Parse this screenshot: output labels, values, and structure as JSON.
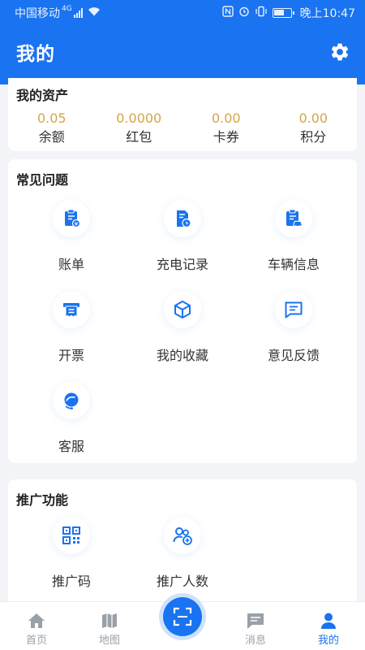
{
  "status_bar": {
    "carrier": "中国移动",
    "network": "4G",
    "time": "晚上10:47"
  },
  "header": {
    "title": "我的"
  },
  "assets": {
    "title": "我的资产",
    "items": [
      {
        "value": "0.05",
        "label": "余额"
      },
      {
        "value": "0.0000",
        "label": "红包"
      },
      {
        "value": "0.00",
        "label": "卡券"
      },
      {
        "value": "0.00",
        "label": "积分"
      }
    ]
  },
  "faq": {
    "title": "常见问题",
    "items": [
      {
        "label": "账单",
        "icon": "bill-icon"
      },
      {
        "label": "充电记录",
        "icon": "charging-record-icon"
      },
      {
        "label": "车辆信息",
        "icon": "vehicle-icon"
      },
      {
        "label": "开票",
        "icon": "invoice-icon"
      },
      {
        "label": "我的收藏",
        "icon": "box-icon"
      },
      {
        "label": "意见反馈",
        "icon": "feedback-icon"
      },
      {
        "label": "客服",
        "icon": "customer-service-icon"
      }
    ]
  },
  "promo": {
    "title": "推广功能",
    "items": [
      {
        "label": "推广码",
        "icon": "qr-code-icon"
      },
      {
        "label": "推广人数",
        "icon": "add-user-icon"
      }
    ]
  },
  "tabs": [
    {
      "label": "首页",
      "icon": "home-icon",
      "active": false
    },
    {
      "label": "地图",
      "icon": "map-icon",
      "active": false
    },
    {
      "label": "",
      "icon": "scan-icon",
      "active": false
    },
    {
      "label": "消息",
      "icon": "message-icon",
      "active": false
    },
    {
      "label": "我的",
      "icon": "user-icon",
      "active": true
    }
  ],
  "colors": {
    "primary": "#1a73f0",
    "asset_value": "#d4a64a",
    "background": "#f2f4f7"
  }
}
